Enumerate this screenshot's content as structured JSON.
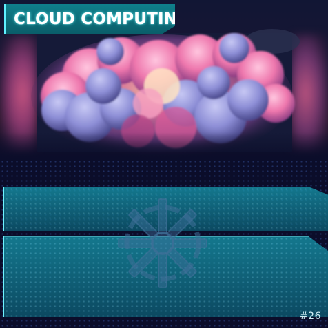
{
  "card": {
    "title": "CLOUD COMPUTING",
    "number": "#26",
    "description": "",
    "effect": ""
  },
  "icons": {
    "emblem": "gear-emblem-icon"
  },
  "colors": {
    "background": "#0b0d2a",
    "accent": "#5ff0ff",
    "banner": "#0f7f8b",
    "panel": "#1696aa",
    "cloud_pink": "#f07db0",
    "cloud_blue": "#8c8fd6"
  }
}
